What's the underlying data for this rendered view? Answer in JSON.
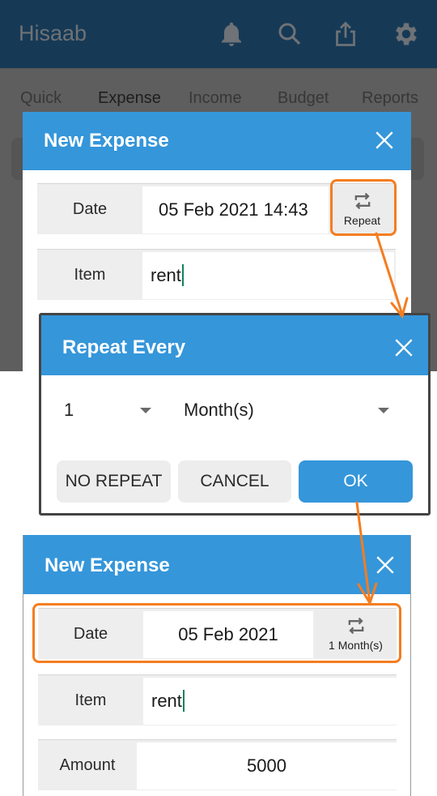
{
  "app": {
    "title": "Hisaab",
    "icons": [
      "bell-icon",
      "search-icon",
      "share-icon",
      "gear-icon"
    ]
  },
  "tabs": [
    {
      "label": "Quick",
      "active": false
    },
    {
      "label": "Expense",
      "active": true
    },
    {
      "label": "Income",
      "active": false
    },
    {
      "label": "Budget",
      "active": false
    },
    {
      "label": "Reports",
      "active": false
    }
  ],
  "dialog_before": {
    "title": "New Expense",
    "date_label": "Date",
    "date_value": "05 Feb 2021  14:43",
    "repeat_label": "Repeat",
    "item_label": "Item",
    "item_value": "rent"
  },
  "repeat_dialog": {
    "title": "Repeat Every",
    "interval_value": "1",
    "unit_value": "Month(s)",
    "buttons": {
      "no_repeat": "NO REPEAT",
      "cancel": "CANCEL",
      "ok": "OK"
    }
  },
  "dialog_after": {
    "title": "New Expense",
    "date_label": "Date",
    "date_value": "05 Feb 2021",
    "repeat_label": "1 Month(s)",
    "item_label": "Item",
    "item_value": "rent",
    "amount_label": "Amount",
    "amount_value": "5000"
  },
  "colors": {
    "accent": "#3596da",
    "appbar": "#163a56",
    "annotation": "#f47d20",
    "caret": "#0e8060"
  }
}
